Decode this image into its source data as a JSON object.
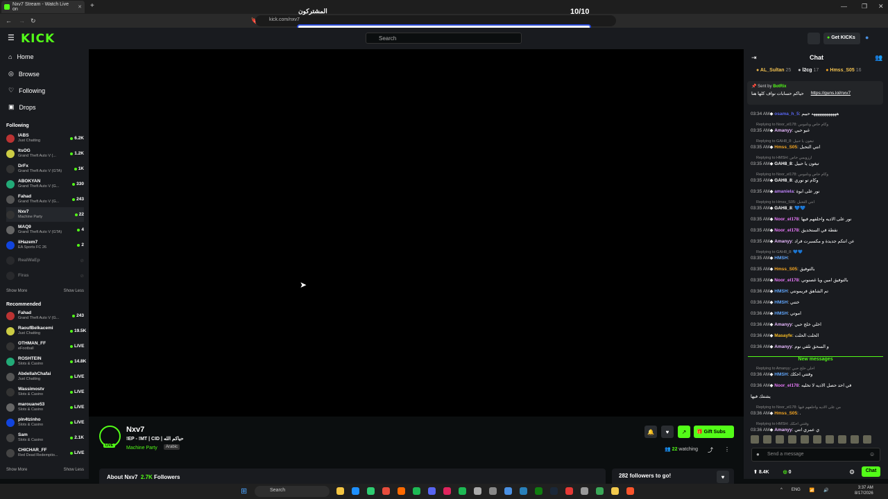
{
  "browser": {
    "tab_title": "Nxv7 Stream - Watch Live on",
    "url": "kick.com/nxv7",
    "new_tab": "+"
  },
  "overlay": {
    "title": "المشتركون",
    "count": "10/10"
  },
  "header": {
    "logo": "KICK",
    "search_placeholder": "Search",
    "get_kicks": "Get KICKs"
  },
  "sidebar": {
    "nav": [
      {
        "label": "Home",
        "icon": "home-icon"
      },
      {
        "label": "Browse",
        "icon": "compass-icon"
      },
      {
        "label": "Following",
        "icon": "heart-icon"
      },
      {
        "label": "Drops",
        "icon": "gift-icon"
      }
    ],
    "following_title": "Following",
    "following": [
      {
        "name": "IABS",
        "game": "Just Chatting",
        "viewers": "6.2K"
      },
      {
        "name": "ItsOG",
        "game": "Grand Theft Auto V (...",
        "viewers": "1.2K"
      },
      {
        "name": "DrFx",
        "game": "Grand Theft Auto V (GTA)",
        "viewers": "1K"
      },
      {
        "name": "ABOKYAN",
        "game": "Grand Theft Auto V (G...",
        "viewers": "330"
      },
      {
        "name": "Fahad",
        "game": "Grand Theft Auto V (G...",
        "viewers": "243"
      },
      {
        "name": "Nxv7",
        "game": "Machine Party",
        "viewers": "22"
      },
      {
        "name": "MAQ9",
        "game": "Grand Theft Auto V (GTA)",
        "viewers": "4"
      },
      {
        "name": "iiHazem7",
        "game": "EA Sports FC 26",
        "viewers": "2"
      },
      {
        "name": "RealWaEp",
        "game": "",
        "viewers": ""
      },
      {
        "name": "Firas",
        "game": "",
        "viewers": ""
      }
    ],
    "show_more": "Show More",
    "show_less": "Show Less",
    "recommended_title": "Recommended",
    "recommended": [
      {
        "name": "Fahad",
        "game": "Grand Theft Auto V (G...",
        "viewers": "243"
      },
      {
        "name": "RaoufBelkacemi",
        "game": "Just Chatting",
        "viewers": "19.5K"
      },
      {
        "name": "OTHMAN_FF",
        "game": "eFootball",
        "viewers": "LIVE"
      },
      {
        "name": "ROSHTEIN",
        "game": "Slots & Casino",
        "viewers": "14.8K"
      },
      {
        "name": "AbdellahChafai",
        "game": "Just Chatting",
        "viewers": "LIVE"
      },
      {
        "name": "Wassimostv",
        "game": "Slots & Casino",
        "viewers": "LIVE"
      },
      {
        "name": "marouane53",
        "game": "Slots & Casino",
        "viewers": "LIVE"
      },
      {
        "name": "pln4tzinho",
        "game": "Slots & Casino",
        "viewers": "LIVE"
      },
      {
        "name": "Sam",
        "game": "Slots & Casino",
        "viewers": "2.1K"
      },
      {
        "name": "CHICHAR_FF",
        "game": "Red Dead Redemptio...",
        "viewers": "LIVE"
      }
    ]
  },
  "stream": {
    "name": "Nxv7",
    "title": "!EP - !MT | CID | حياكم الله",
    "category": "Machine Party",
    "language": "Arabic",
    "live_badge": "LIVE",
    "gift_subs": "Gift Subs",
    "watching_count": "22",
    "watching_label": "watching",
    "about_label": "About Nxv7",
    "followers_count": "2.7K",
    "followers_label": "Followers",
    "goal": "282 followers to go!"
  },
  "chat": {
    "title": "Chat",
    "gifters": [
      {
        "name": "AL_Sultan",
        "count": "25"
      },
      {
        "name": "l2cg",
        "count": "17"
      },
      {
        "name": "Hmss_S05",
        "count": "16"
      }
    ],
    "pinned_sender": "BotRix",
    "pinned_prefix": "Sent by",
    "pinned_text": "حياكم حسابات نواف كلها هنا",
    "pinned_link": "https://guns.lol/nxv7",
    "messages": [
      {
        "time": "03:34 AM",
        "user": "osama_h_5",
        "color": "#5865f2",
        "text": "ههههههههههههه حييم",
        "reply": ""
      },
      {
        "time": "03:35 AM",
        "user": "Amanyy",
        "color": "#e8b9ff",
        "text": "غبو حبي",
        "reply": "Replying to Noor_el178: وكام خاص وناموس"
      },
      {
        "time": "03:35 AM",
        "user": "Hmss_S05",
        "color": "#f5a623",
        "text": "انتي التحبل",
        "reply": "Replying to GAH8_8: تبغون يا حبيل"
      },
      {
        "time": "03:35 AM",
        "user": "GAH8_8",
        "color": "#ffffff",
        "text": "تبغون يا حبيل",
        "reply": "Replying to HMSH: ارزوبمي خاص"
      },
      {
        "time": "03:35 AM",
        "user": "GAH8_8",
        "color": "#ffffff",
        "text": "وكام تو نوري",
        "reply": "Replying to Noor_el178: وكام خاص وناموس"
      },
      {
        "time": "03:35 AM",
        "user": "amaniela",
        "color": "#c084fc",
        "text": "نور على ابوة",
        "reply": ""
      },
      {
        "time": "03:35 AM",
        "user": "GAH8_8",
        "color": "#ffffff",
        "text": "💙💙",
        "reply": "Replying to Hmss_S05: انتي التحبل"
      },
      {
        "time": "03:35 AM",
        "user": "Noor_el178",
        "color": "#e879f9",
        "text": "نور على الاديه واحلفهم فيها",
        "reply": ""
      },
      {
        "time": "03:35 AM",
        "user": "Noor_el178",
        "color": "#e879f9",
        "text": "نقطة في الستخديق",
        "reply": ""
      },
      {
        "time": "03:35 AM",
        "user": "Amanyy",
        "color": "#e8b9ff",
        "text": "عن انتكم جديدة و مكسبرت فراد",
        "reply": ""
      },
      {
        "time": "03:35 AM",
        "user": "HMSH",
        "color": "#60a5fa",
        "text": "",
        "reply": "Replying to GAH8_8: 💙💙"
      },
      {
        "time": "03:35 AM",
        "user": "Hmss_S05",
        "color": "#f5a623",
        "text": "بالتوفيق",
        "reply": ""
      },
      {
        "time": "03:35 AM",
        "user": "Noor_el178",
        "color": "#e879f9",
        "text": "بالتوفيق امين ويا غصنوني",
        "reply": ""
      },
      {
        "time": "03:36 AM",
        "user": "HMSH",
        "color": "#60a5fa",
        "text": "تم الشاهق فريمونتي",
        "reply": ""
      },
      {
        "time": "03:36 AM",
        "user": "HMSH",
        "color": "#60a5fa",
        "text": "ختني",
        "reply": ""
      },
      {
        "time": "03:36 AM",
        "user": "HMSH",
        "color": "#60a5fa",
        "text": "اموتي",
        "reply": ""
      },
      {
        "time": "03:36 AM",
        "user": "Amanyy",
        "color": "#e8b9ff",
        "text": "اخلي خلج حبي",
        "reply": ""
      },
      {
        "time": "03:36 AM",
        "user": "Masayfe",
        "color": "#fbbf24",
        "text": "الحلت الحلت",
        "reply": ""
      },
      {
        "time": "03:36 AM",
        "user": "Amanyy",
        "color": "#e8b9ff",
        "text": "و السحق تلقي نوم",
        "reply": ""
      }
    ],
    "new_messages": "New messages",
    "messages_after": [
      {
        "time": "03:36 AM",
        "user": "HMSH",
        "color": "#60a5fa",
        "text": "وقتتي احكك",
        "reply": "Replying to Amanyy: احلي خلج حبي"
      },
      {
        "time": "03:36 AM",
        "user": "Noor_el178",
        "color": "#e879f9",
        "text": "في احد حصل الاديه لا تخليه",
        "reply": ""
      },
      {
        "time": "",
        "user": "",
        "color": "#ffffff",
        "text": "يشتتك فيها",
        "reply": ""
      },
      {
        "time": "03:36 AM",
        "user": "Hmss_S05",
        "color": "#f5a623",
        "text": ".",
        "reply": "Replying to Noor_el178: من على الاديه واحلفهم فيها"
      },
      {
        "time": "03:36 AM",
        "user": "Amanyy",
        "color": "#e8b9ff",
        "text": "ي عمري انتي",
        "reply": "Replying to HMSH: وقتتي احكك"
      }
    ],
    "input_placeholder": "Send a message",
    "send_label": "Chat",
    "kicks": "8.4K",
    "points": "0"
  },
  "taskbar": {
    "search": "Search",
    "lang": "ENG",
    "time": "3:37 AM",
    "date": "8/17/2026"
  }
}
